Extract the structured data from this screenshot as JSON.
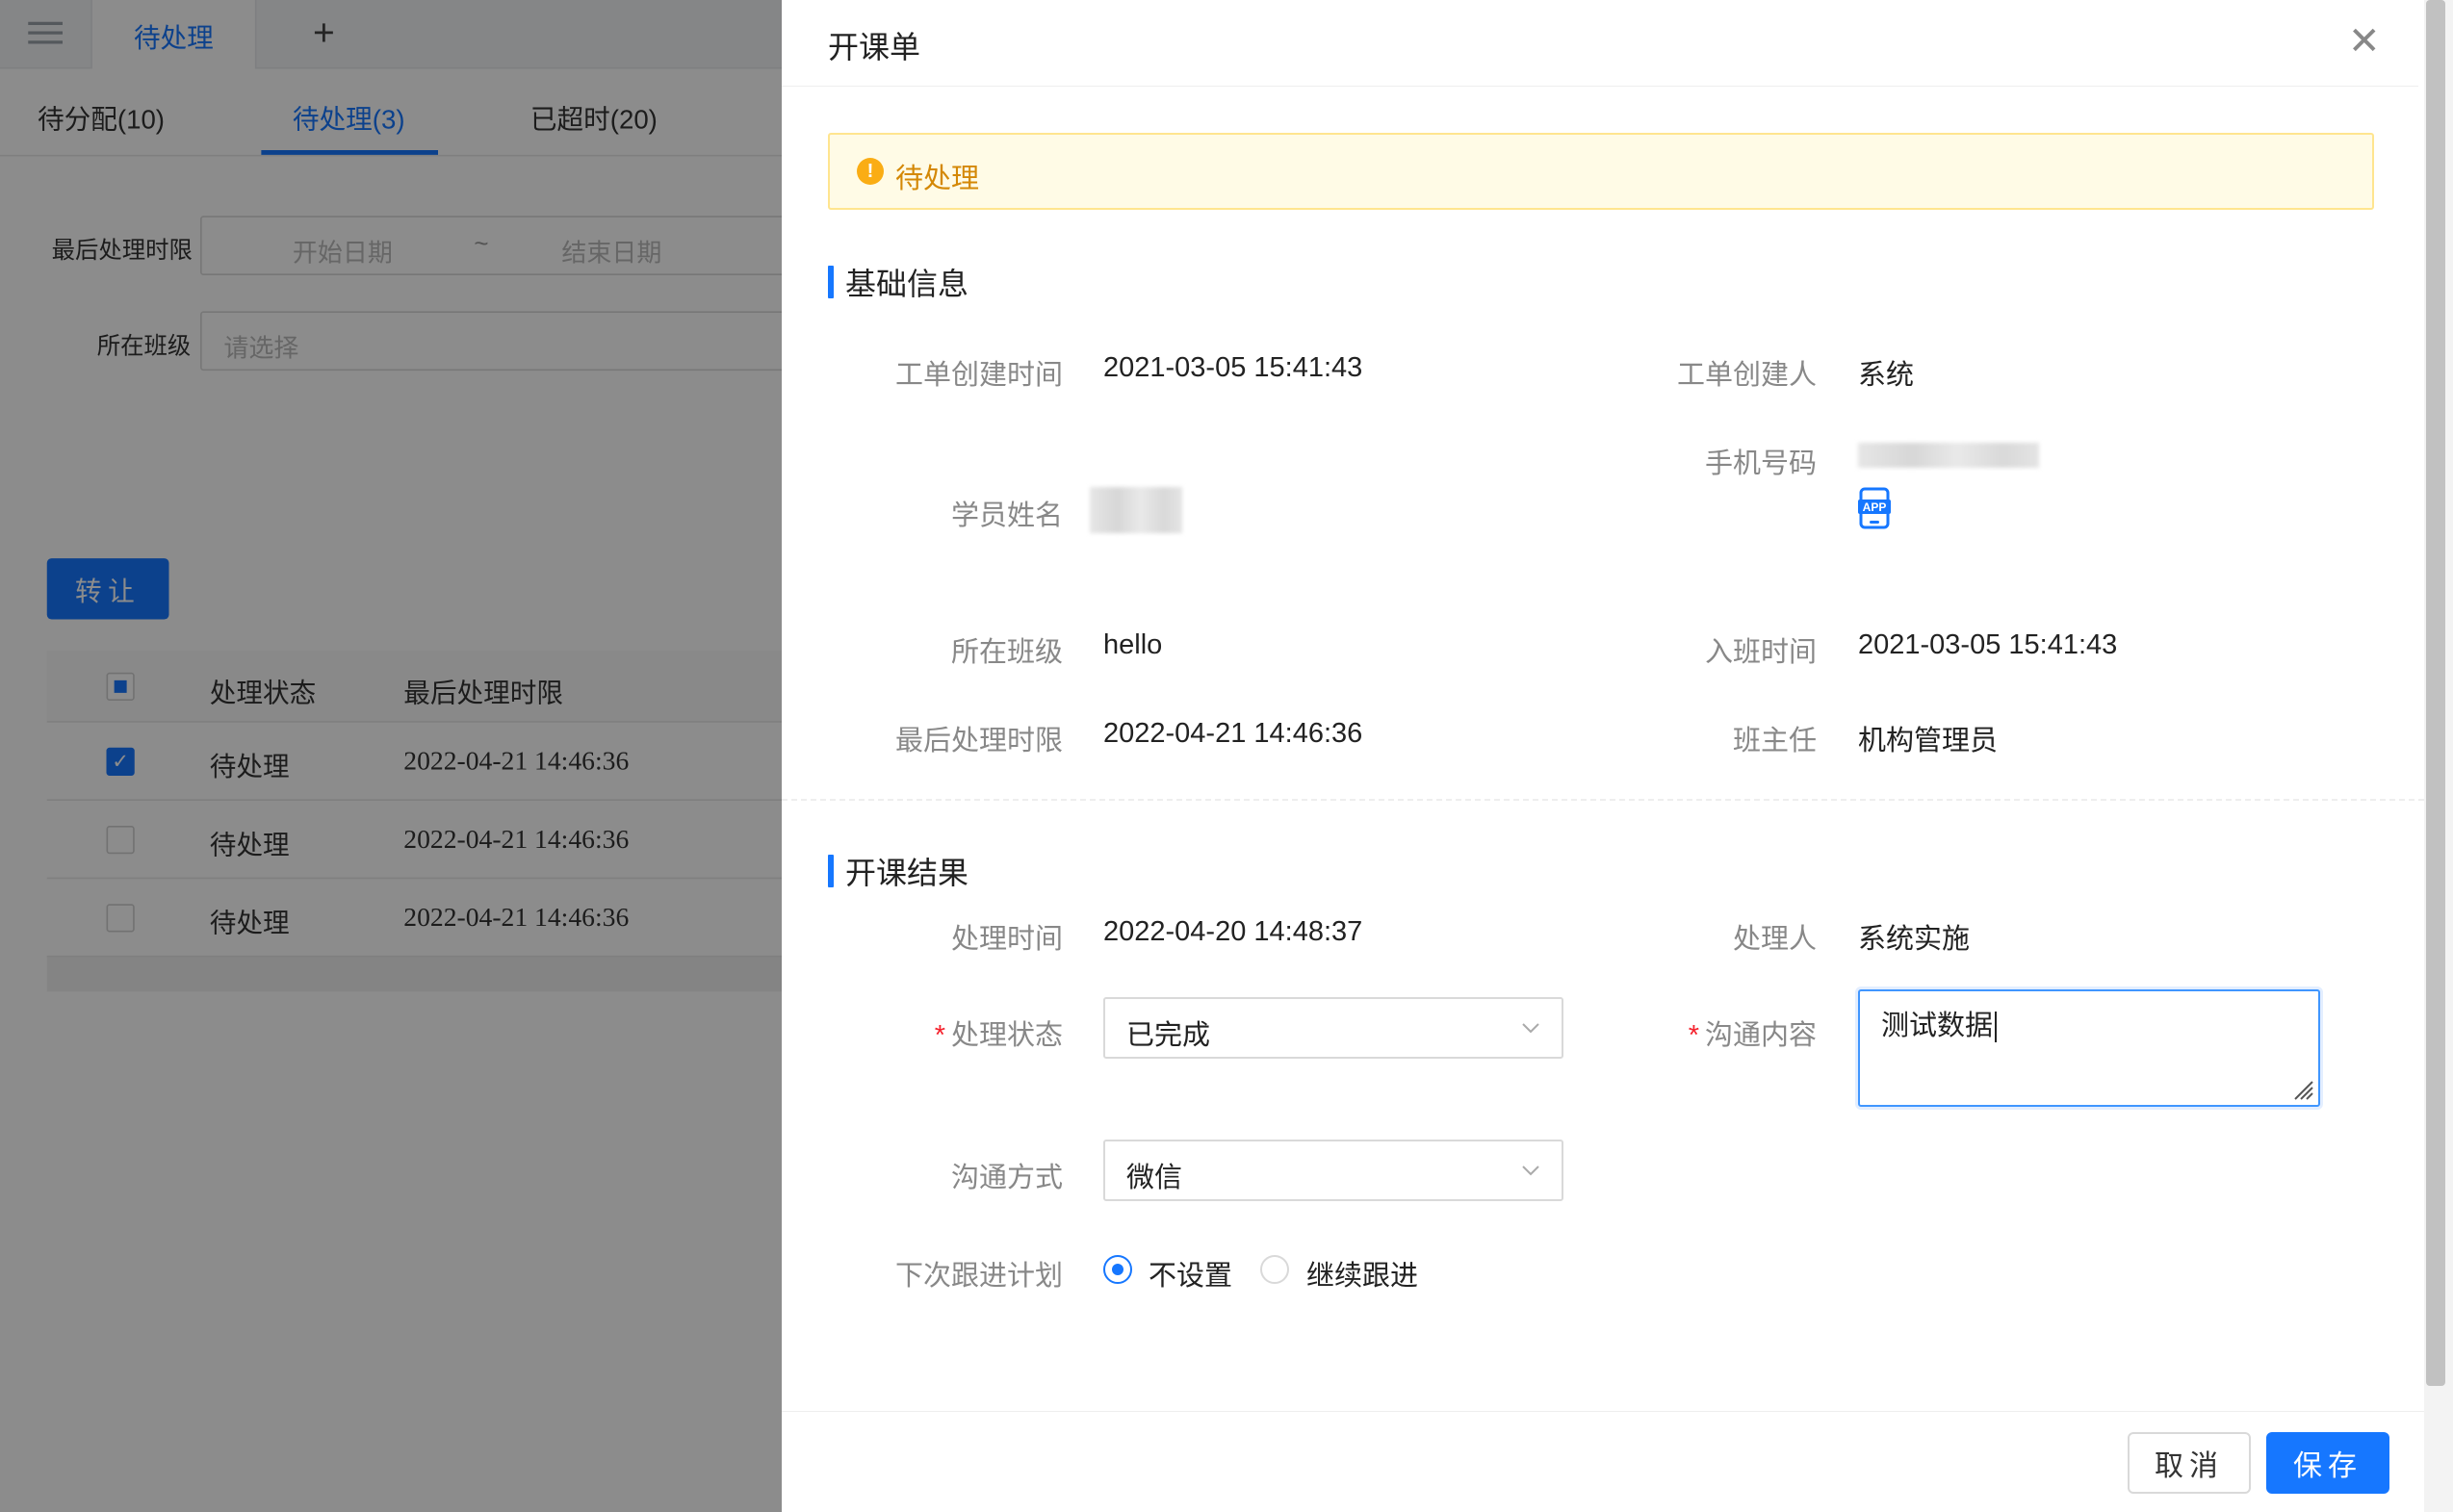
{
  "background": {
    "tab_active": "待处理",
    "tab_add": "+",
    "subtabs": [
      "待分配(10)",
      "待处理(3)",
      "已超时(20)"
    ],
    "filters": {
      "deadline_label": "最后处理时限",
      "start_placeholder": "开始日期",
      "range_sep": "~",
      "end_placeholder": "结束日期",
      "class_label": "所在班级",
      "class_placeholder": "请选择"
    },
    "transfer_button": "转让",
    "table": {
      "columns": [
        "处理状态",
        "最后处理时限"
      ],
      "rows": [
        {
          "status": "待处理",
          "deadline": "2022-04-21 14:46:36",
          "checked": true
        },
        {
          "status": "待处理",
          "deadline": "2022-04-21 14:46:36",
          "checked": false
        },
        {
          "status": "待处理",
          "deadline": "2022-04-21 14:46:36",
          "checked": false
        }
      ]
    }
  },
  "drawer": {
    "title": "开课单",
    "status_alert": "待处理",
    "basic_section": "基础信息",
    "basic": {
      "created_time_label": "工单创建时间",
      "created_time": "2021-03-05 15:41:43",
      "creator_label": "工单创建人",
      "creator": "系统",
      "phone_label": "手机号码",
      "app_badge": "APP",
      "student_label": "学员姓名",
      "class_label": "所在班级",
      "class_value": "hello",
      "join_time_label": "入班时间",
      "join_time": "2021-03-05 15:41:43",
      "deadline_label": "最后处理时限",
      "deadline": "2022-04-21 14:46:36",
      "head_teacher_label": "班主任",
      "head_teacher": "机构管理员"
    },
    "result_section": "开课结果",
    "result": {
      "handle_time_label": "处理时间",
      "handle_time": "2022-04-20 14:48:37",
      "handler_label": "处理人",
      "handler": "系统实施",
      "status_label": "处理状态",
      "status_value": "已完成",
      "content_label": "沟通内容",
      "content_value": "测试数据",
      "method_label": "沟通方式",
      "method_value": "微信",
      "plan_label": "下次跟进计划",
      "plan_options": [
        "不设置",
        "继续跟进"
      ],
      "plan_selected": "不设置"
    },
    "required_mark": "*",
    "cancel_button": "取消",
    "save_button": "保存"
  },
  "colors": {
    "primary": "#1677ff",
    "warning_bg": "#fffbe6",
    "warning_text": "#d48806",
    "required": "#f5222d"
  }
}
